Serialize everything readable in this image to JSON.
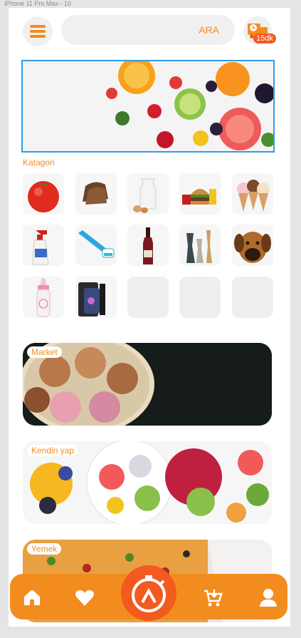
{
  "frame": {
    "label": "iPhone 11 Pro Max - 10"
  },
  "header": {
    "menu_icon": "hamburger-icon",
    "search": {
      "label": "ARA"
    },
    "delivery": {
      "icon": "delivery-truck-icon",
      "badge": "15dk"
    }
  },
  "hero": {
    "description": "fruit-banner-image"
  },
  "categories": {
    "title": "Katagori",
    "items": [
      {
        "icon": "tomato-icon"
      },
      {
        "icon": "bread-icon"
      },
      {
        "icon": "milk-eggs-icon"
      },
      {
        "icon": "burger-icon"
      },
      {
        "icon": "ice-cream-icon"
      },
      {
        "icon": "spray-bottle-icon"
      },
      {
        "icon": "toothbrush-icon"
      },
      {
        "icon": "wine-bottle-icon"
      },
      {
        "icon": "vase-icon"
      },
      {
        "icon": "dog-icon"
      },
      {
        "icon": "baby-bottle-icon"
      },
      {
        "icon": "phone-case-icon"
      },
      {
        "icon": ""
      },
      {
        "icon": ""
      },
      {
        "icon": ""
      }
    ]
  },
  "banners": [
    {
      "label": "Market",
      "image": "macarons-image"
    },
    {
      "label": "Kendin yap",
      "image": "fruit-bowl-image"
    },
    {
      "label": "Yemek",
      "image": "pizza-image"
    }
  ],
  "bottom_nav": {
    "items": [
      "home-icon",
      "heart-icon",
      "orders-timer-icon",
      "cart-icon",
      "profile-icon"
    ],
    "accent": "#f28c1f",
    "center_accent": "#f25a1f"
  }
}
